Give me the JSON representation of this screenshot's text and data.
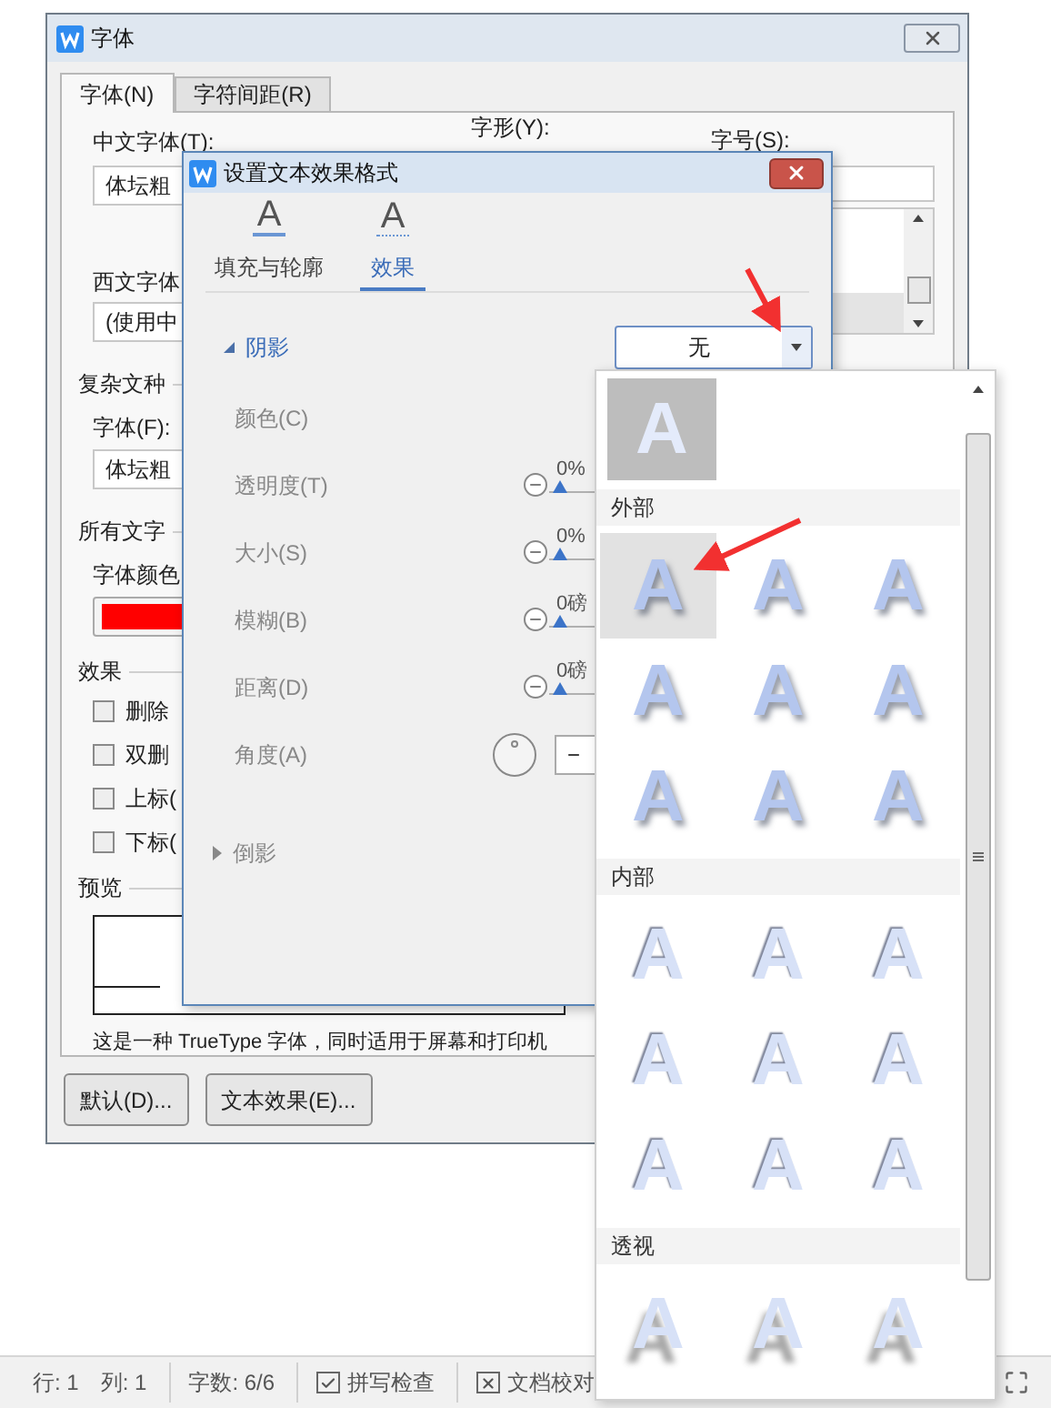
{
  "font_dialog": {
    "title": "字体",
    "tabs": [
      {
        "label": "字体(N)",
        "selected": true
      },
      {
        "label": "字符间距(R)",
        "selected": false
      }
    ],
    "chinese_font": {
      "label": "中文字体(T):",
      "value": "体坛粗"
    },
    "style_label": "字形(Y):",
    "size_label": "字号(S):",
    "western_font": {
      "label": "西文字体",
      "value": "(使用中"
    },
    "complex_group": "复杂文种",
    "complex_font": {
      "label": "字体(F):",
      "value": "体坛粗"
    },
    "all_text_group": "所有文字",
    "font_color": {
      "label": "字体颜色",
      "color": "#ff0000"
    },
    "effects_group": "效果",
    "effects": [
      {
        "label": "删除",
        "checked": false
      },
      {
        "label": "双删",
        "checked": false
      },
      {
        "label": "上标(",
        "checked": false
      },
      {
        "label": "下标(",
        "checked": false
      }
    ],
    "preview_group": "预览",
    "description": "这是一种 TrueType 字体，同时适用于屏幕和打印机",
    "buttons": [
      "默认(D)...",
      "文本效果(E)..."
    ]
  },
  "effects_dialog": {
    "title": "设置文本效果格式",
    "tabs": [
      {
        "label": "填充与轮廓",
        "glyph": "A",
        "kind": "fill",
        "selected": false
      },
      {
        "label": "效果",
        "glyph": "A",
        "kind": "effect",
        "selected": true
      }
    ],
    "sections": [
      {
        "title": "阴影",
        "expanded": true,
        "preset": "无",
        "rows": [
          {
            "kind": "color",
            "label": "颜色(C)"
          },
          {
            "kind": "slider",
            "label": "透明度(T)",
            "reading": "0%",
            "level": 0
          },
          {
            "kind": "slider",
            "label": "大小(S)",
            "reading": "0%",
            "level": 0
          },
          {
            "kind": "slider",
            "label": "模糊(B)",
            "reading": "0磅",
            "level": 0
          },
          {
            "kind": "slider",
            "label": "距离(D)",
            "reading": "0磅",
            "level": 0
          },
          {
            "kind": "angle",
            "label": "角度(A)",
            "value": "−"
          }
        ]
      },
      {
        "title": "倒影",
        "expanded": false
      }
    ]
  },
  "shadow_gallery": {
    "none_tile": {
      "sample": "A"
    },
    "groups": [
      {
        "title": "外部",
        "kind": "outer",
        "items": [
          {
            "sample": "A",
            "selected": true
          },
          {
            "sample": "A",
            "selected": false
          },
          {
            "sample": "A",
            "selected": false
          },
          {
            "sample": "A",
            "selected": false
          },
          {
            "sample": "A",
            "selected": false
          },
          {
            "sample": "A",
            "selected": false
          },
          {
            "sample": "A",
            "selected": false
          },
          {
            "sample": "A",
            "selected": false
          },
          {
            "sample": "A",
            "selected": false
          }
        ]
      },
      {
        "title": "内部",
        "kind": "inner",
        "items": [
          {
            "sample": "A",
            "selected": false
          },
          {
            "sample": "A",
            "selected": false
          },
          {
            "sample": "A",
            "selected": false
          },
          {
            "sample": "A",
            "selected": false
          },
          {
            "sample": "A",
            "selected": false
          },
          {
            "sample": "A",
            "selected": false
          },
          {
            "sample": "A",
            "selected": false
          },
          {
            "sample": "A",
            "selected": false
          },
          {
            "sample": "A",
            "selected": false
          }
        ]
      },
      {
        "title": "透视",
        "kind": "perspective",
        "items": [
          {
            "sample": "A",
            "selected": false
          },
          {
            "sample": "A",
            "selected": false
          },
          {
            "sample": "A",
            "selected": false
          }
        ]
      }
    ]
  },
  "status_bar": [
    {
      "kind": "text",
      "label": "行: 1"
    },
    {
      "kind": "text",
      "label": "列: 1"
    },
    {
      "kind": "text",
      "label": "字数: 6/6"
    },
    {
      "kind": "check",
      "label": "拼写检查"
    },
    {
      "kind": "cross",
      "label": "文档校对"
    }
  ]
}
